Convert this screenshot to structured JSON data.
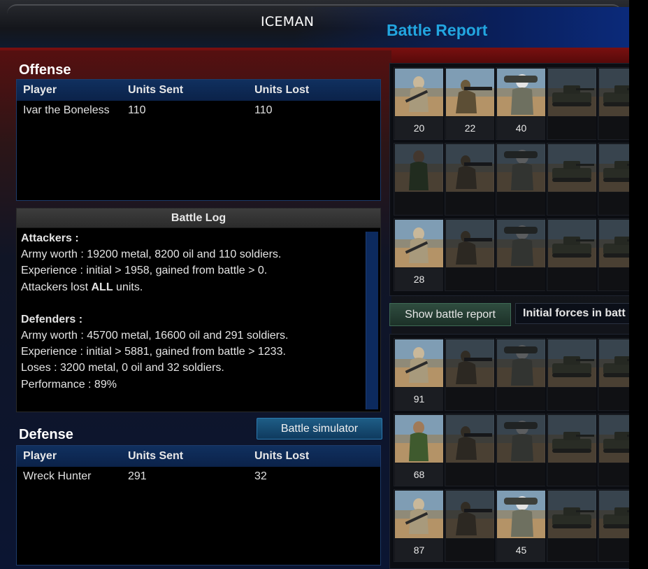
{
  "header": {
    "player_name": "ICEMAN",
    "title": "Battle Report"
  },
  "offense": {
    "title": "Offense",
    "columns": [
      "Player",
      "Units Sent",
      "Units Lost"
    ],
    "rows": [
      {
        "player": "Ivar the Boneless",
        "sent": "110",
        "lost": "110"
      }
    ]
  },
  "battle_log": {
    "title": "Battle Log",
    "attackers_heading": "Attackers :",
    "attackers_worth": "Army worth : 19200 metal, 8200 oil and 110 soldiers.",
    "attackers_exp": "Experience : initial > 1958, gained from battle > 0.",
    "attackers_lost_pre": "Attackers lost ",
    "attackers_lost_all": "ALL",
    "attackers_lost_post": " units.",
    "defenders_heading": "Defenders :",
    "defenders_worth": "Army worth : 45700 metal, 16600 oil and 291 soldiers.",
    "defenders_exp": "Experience : initial > 5881, gained from battle > 1233.",
    "defenders_loses": "Loses : 3200 metal, 0 oil and 32 soldiers.",
    "defenders_performance": "Performance : 89%"
  },
  "defense": {
    "title": "Defense",
    "columns": [
      "Player",
      "Units Sent",
      "Units Lost"
    ],
    "rows": [
      {
        "player": "Wreck Hunter",
        "sent": "291",
        "lost": "32"
      }
    ]
  },
  "buttons": {
    "battle_simulator": "Battle simulator",
    "show_battle_report": "Show battle report",
    "initial_forces": "Initial forces in batt"
  },
  "attacker_units": {
    "rows": [
      [
        {
          "type": "sniper",
          "count": "20",
          "active": true
        },
        {
          "type": "rifleman",
          "count": "22",
          "active": true
        },
        {
          "type": "rocket",
          "count": "40",
          "active": true
        },
        {
          "type": "tank",
          "count": "",
          "active": false
        },
        {
          "type": "tank",
          "count": "",
          "active": false
        }
      ],
      [
        {
          "type": "soldier",
          "count": "",
          "active": false
        },
        {
          "type": "rifleman",
          "count": "",
          "active": false
        },
        {
          "type": "rocket",
          "count": "",
          "active": false
        },
        {
          "type": "tank",
          "count": "",
          "active": false
        },
        {
          "type": "tank",
          "count": "",
          "active": false
        }
      ],
      [
        {
          "type": "sniper",
          "count": "28",
          "active": true
        },
        {
          "type": "rifleman",
          "count": "",
          "active": false
        },
        {
          "type": "rocket",
          "count": "",
          "active": false
        },
        {
          "type": "tank",
          "count": "",
          "active": false
        },
        {
          "type": "tank",
          "count": "",
          "active": false
        }
      ]
    ]
  },
  "defender_units": {
    "rows": [
      [
        {
          "type": "sniper",
          "count": "91",
          "active": true
        },
        {
          "type": "rifleman",
          "count": "",
          "active": false
        },
        {
          "type": "rocket",
          "count": "",
          "active": false
        },
        {
          "type": "tank",
          "count": "",
          "active": false
        },
        {
          "type": "tank",
          "count": "",
          "active": false
        }
      ],
      [
        {
          "type": "soldier",
          "count": "68",
          "active": true
        },
        {
          "type": "rifleman",
          "count": "",
          "active": false
        },
        {
          "type": "rocket",
          "count": "",
          "active": false
        },
        {
          "type": "tank",
          "count": "",
          "active": false
        },
        {
          "type": "tank",
          "count": "",
          "active": false
        }
      ],
      [
        {
          "type": "sniper",
          "count": "87",
          "active": true
        },
        {
          "type": "rifleman",
          "count": "",
          "active": false
        },
        {
          "type": "rocket",
          "count": "45",
          "active": true
        },
        {
          "type": "tank",
          "count": "",
          "active": false
        },
        {
          "type": "tank",
          "count": "",
          "active": false
        }
      ]
    ]
  }
}
